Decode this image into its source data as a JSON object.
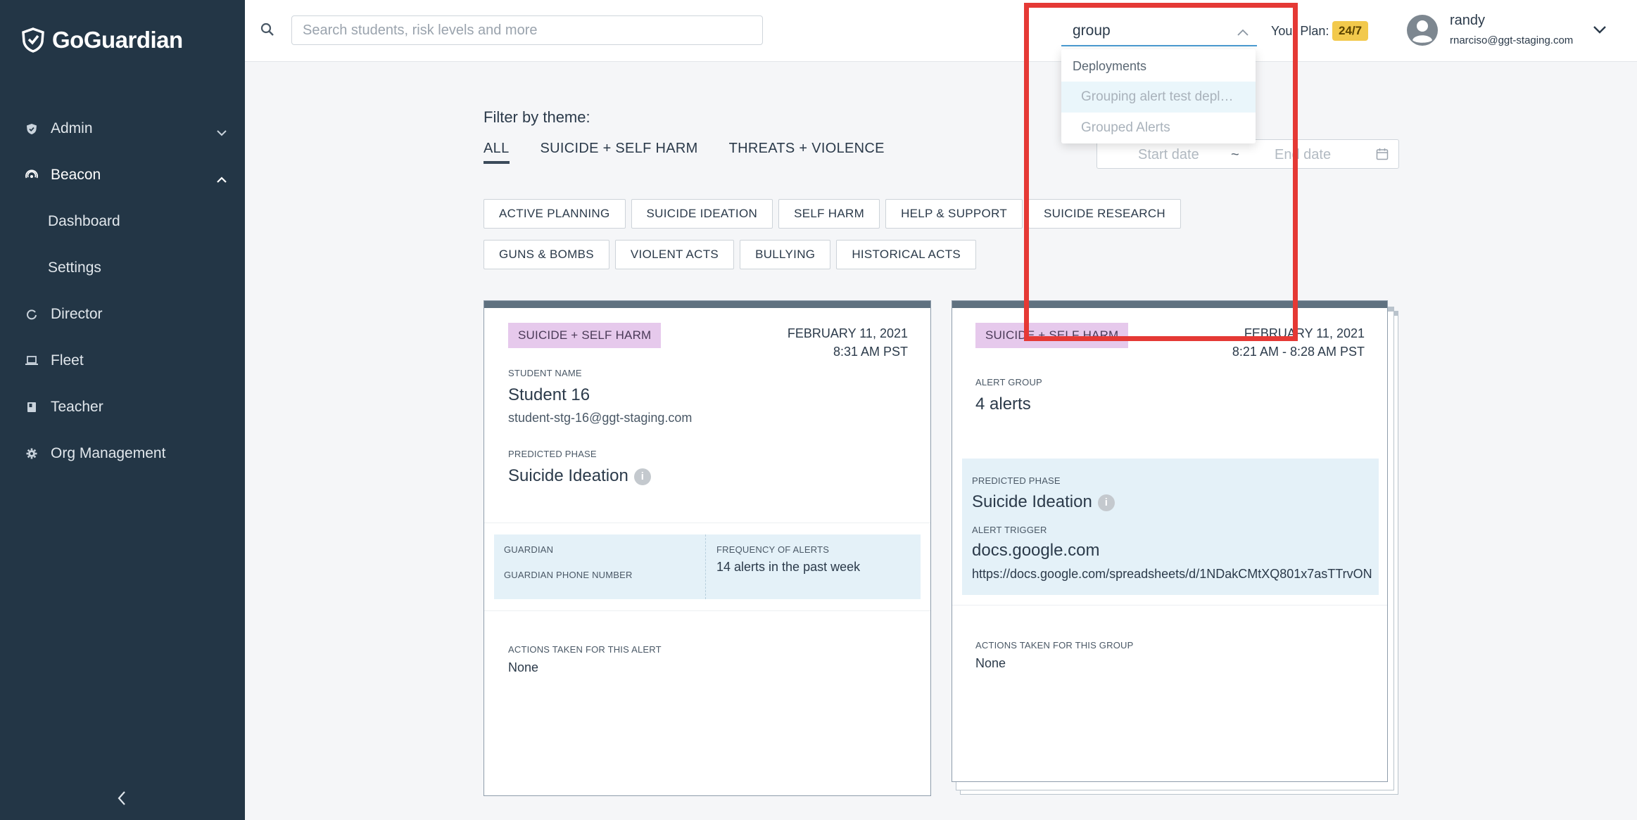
{
  "brand": {
    "name": "GoGuardian"
  },
  "sidebar": {
    "items": [
      {
        "label": "Admin",
        "icon": "shield-check-icon",
        "expanded": false
      },
      {
        "label": "Beacon",
        "icon": "beacon-icon",
        "expanded": true
      },
      {
        "label": "Dashboard",
        "sub": true
      },
      {
        "label": "Settings",
        "sub": true
      },
      {
        "label": "Director",
        "icon": "director-icon"
      },
      {
        "label": "Fleet",
        "icon": "laptop-icon"
      },
      {
        "label": "Teacher",
        "icon": "book-icon"
      },
      {
        "label": "Org Management",
        "icon": "gear-icon"
      }
    ]
  },
  "topbar": {
    "search_placeholder": "Search students, risk levels and more",
    "group_value": "group",
    "plan_label": "Your Plan:",
    "plan_badge": "24/7",
    "user_name": "randy",
    "user_email": "rnarciso@ggt-staging.com"
  },
  "dropdown": {
    "header": "Deployments",
    "items": [
      {
        "label": "Grouping alert test deployment",
        "highlighted": true
      },
      {
        "label": "Grouped Alerts",
        "highlighted": false
      }
    ]
  },
  "filters": {
    "label": "Filter by theme:",
    "tabs": [
      "ALL",
      "SUICIDE + SELF HARM",
      "THREATS + VIOLENCE"
    ],
    "active_tab": "ALL",
    "chips_row1": [
      "ACTIVE PLANNING",
      "SUICIDE IDEATION",
      "SELF HARM",
      "HELP & SUPPORT",
      "SUICIDE RESEARCH"
    ],
    "chips_row2": [
      "GUNS & BOMBS",
      "VIOLENT ACTS",
      "BULLYING",
      "HISTORICAL ACTS"
    ]
  },
  "daterange": {
    "start_placeholder": "Start date",
    "separator": "~",
    "end_placeholder": "End date"
  },
  "card1": {
    "badge": "SUICIDE + SELF HARM",
    "date": "FEBRUARY 11, 2021",
    "time": "8:31 AM PST",
    "student_label": "STUDENT NAME",
    "student_name": "Student 16",
    "student_email": "student-stg-16@ggt-staging.com",
    "phase_label": "PREDICTED PHASE",
    "phase": "Suicide Ideation",
    "guardian_label": "GUARDIAN",
    "guardian_phone_label": "GUARDIAN PHONE NUMBER",
    "freq_label": "FREQUENCY OF ALERTS",
    "freq_value": "14 alerts in the past week",
    "actions_label": "ACTIONS TAKEN FOR THIS ALERT",
    "actions_value": "None"
  },
  "card2": {
    "badge": "SUICIDE + SELF HARM",
    "date": "FEBRUARY 11, 2021",
    "time": "8:21 AM - 8:28 AM PST",
    "group_label": "ALERT GROUP",
    "group_value": "4 alerts",
    "phase_label": "PREDICTED PHASE",
    "phase": "Suicide Ideation",
    "trigger_label": "ALERT TRIGGER",
    "trigger_domain": "docs.google.com",
    "trigger_url": "https://docs.google.com/spreadsheets/d/1NDakCMtXQ801x7asTTrvON...",
    "actions_label": "ACTIONS TAKEN FOR THIS GROUP",
    "actions_value": "None"
  },
  "colors": {
    "sidebar": "#233646",
    "badge": "#e6c9ec",
    "plan_badge": "#f2c94c",
    "highlight": "#e53935",
    "panel": "#e4f1f8"
  }
}
